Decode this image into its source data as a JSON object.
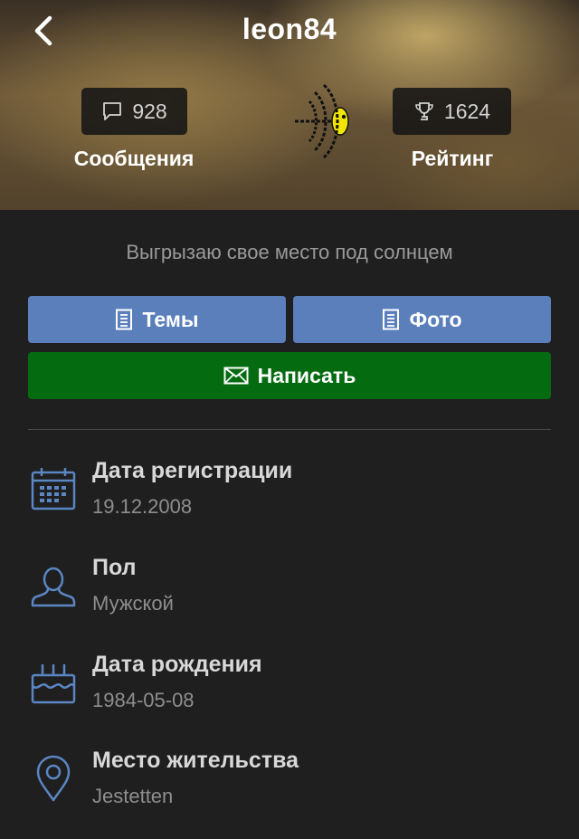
{
  "header": {
    "title": "leon84",
    "back_icon": "chevron-left-icon",
    "messages": {
      "count": "928",
      "label": "Сообщения",
      "icon": "chat-bubble-icon"
    },
    "rating": {
      "count": "1624",
      "label": "Рейтинг",
      "icon": "trophy-icon"
    },
    "avatar_colors": {
      "face": "#f2e600",
      "lines": "#111111"
    }
  },
  "profile": {
    "status": "Выгрызаю свое место под солнцем",
    "buttons": {
      "topics": {
        "label": "Темы",
        "icon": "document-icon"
      },
      "photo": {
        "label": "Фото",
        "icon": "document-icon"
      },
      "write": {
        "label": "Написать",
        "icon": "envelope-icon"
      }
    },
    "colors": {
      "blue_button": "#5a7fbb",
      "green_button": "#046b10",
      "icon_accent": "#5a86c4"
    }
  },
  "info": [
    {
      "label": "Дата регистрации",
      "value": "19.12.2008",
      "icon": "calendar-icon"
    },
    {
      "label": "Пол",
      "value": "Мужской",
      "icon": "user-icon"
    },
    {
      "label": "Дата рождения",
      "value": "1984-05-08",
      "icon": "cake-icon"
    },
    {
      "label": "Место жительства",
      "value": "Jestetten",
      "icon": "location-pin-icon"
    }
  ]
}
